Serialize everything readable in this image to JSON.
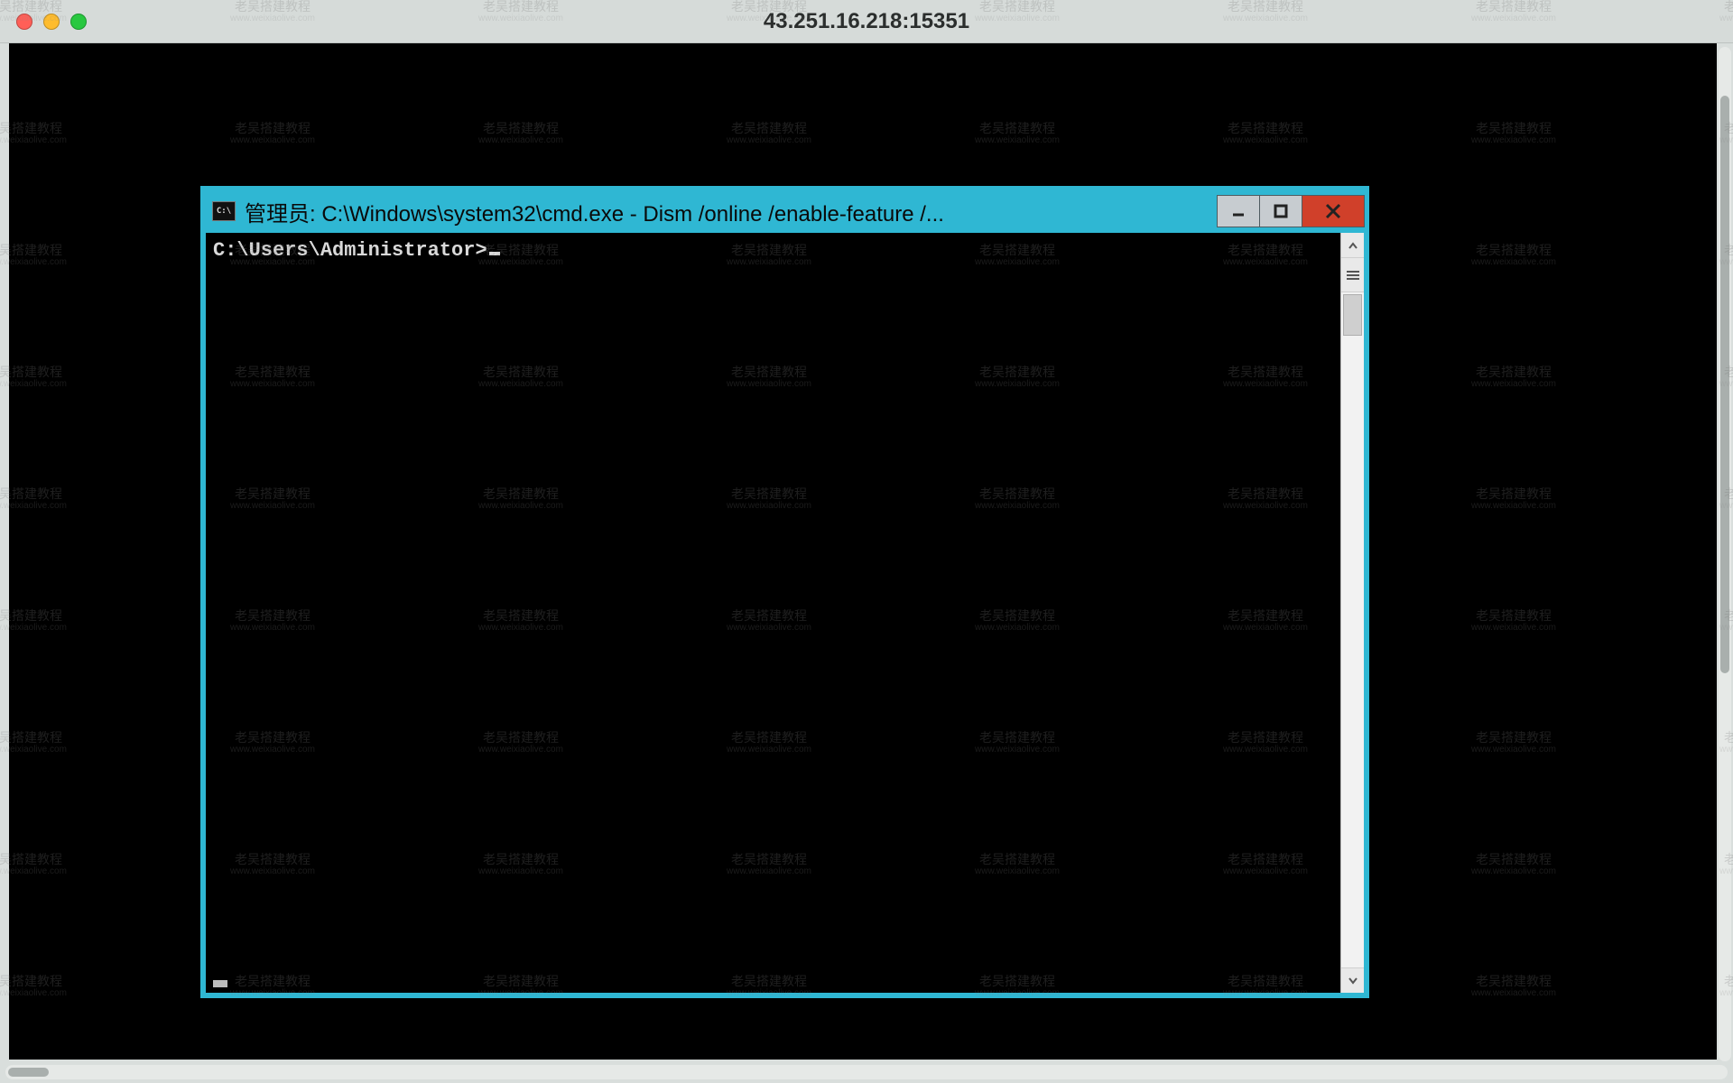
{
  "mac_window": {
    "title": "43.251.16.218:15351"
  },
  "cmd_window": {
    "icon_name": "cmd-icon",
    "title": "管理员: C:\\Windows\\system32\\cmd.exe - Dism  /online /enable-feature /...",
    "buttons": {
      "minimize": "—",
      "maximize": "▢",
      "close": "✕"
    },
    "prompt": "C:\\Users\\Administrator>"
  },
  "watermark": {
    "line1": "老吴搭建教程",
    "line2": "www.weixiaolive.com"
  }
}
